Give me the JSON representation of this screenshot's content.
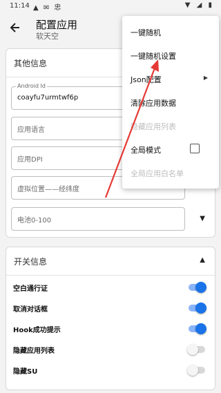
{
  "status_bar": {
    "time": "11:14",
    "left_icons": "▲ ✉ 忠",
    "right_icons": "▼ ◢ ▮"
  },
  "app_bar": {
    "title": "配置应用",
    "subtitle": "软天空",
    "back_icon": "arrow-back-icon"
  },
  "other_info": {
    "header": "其他信息",
    "android_id": {
      "label": "Android Id",
      "value": "coayfu7urmtwf6p"
    },
    "fields": [
      {
        "placeholder": "应用语言"
      },
      {
        "placeholder": "应用DPI"
      },
      {
        "placeholder": "虚拟位置——经纬度"
      },
      {
        "placeholder": "电池0-100"
      }
    ]
  },
  "switch_info": {
    "header": "开关信息",
    "rows": [
      {
        "label": "空白通行证",
        "on": true
      },
      {
        "label": "取消对话框",
        "on": true
      },
      {
        "label": "Hook成功提示",
        "on": true
      },
      {
        "label": "隐藏应用列表",
        "on": false
      },
      {
        "label": "隐藏SU",
        "on": false
      }
    ]
  },
  "menu": {
    "items": [
      {
        "label": "一键随机",
        "enabled": true
      },
      {
        "label": "一键随机设置",
        "enabled": true
      },
      {
        "label": "Json配置",
        "enabled": true,
        "submenu": true
      },
      {
        "label": "清除应用数据",
        "enabled": true
      },
      {
        "label": "隐藏应用列表",
        "enabled": false
      },
      {
        "label": "全局模式",
        "enabled": true,
        "checkbox": true,
        "checked": false
      },
      {
        "label": "全局应用白名单",
        "enabled": false
      }
    ]
  },
  "colors": {
    "accent": "#1a73e8",
    "annotation_arrow": "#e53935"
  }
}
